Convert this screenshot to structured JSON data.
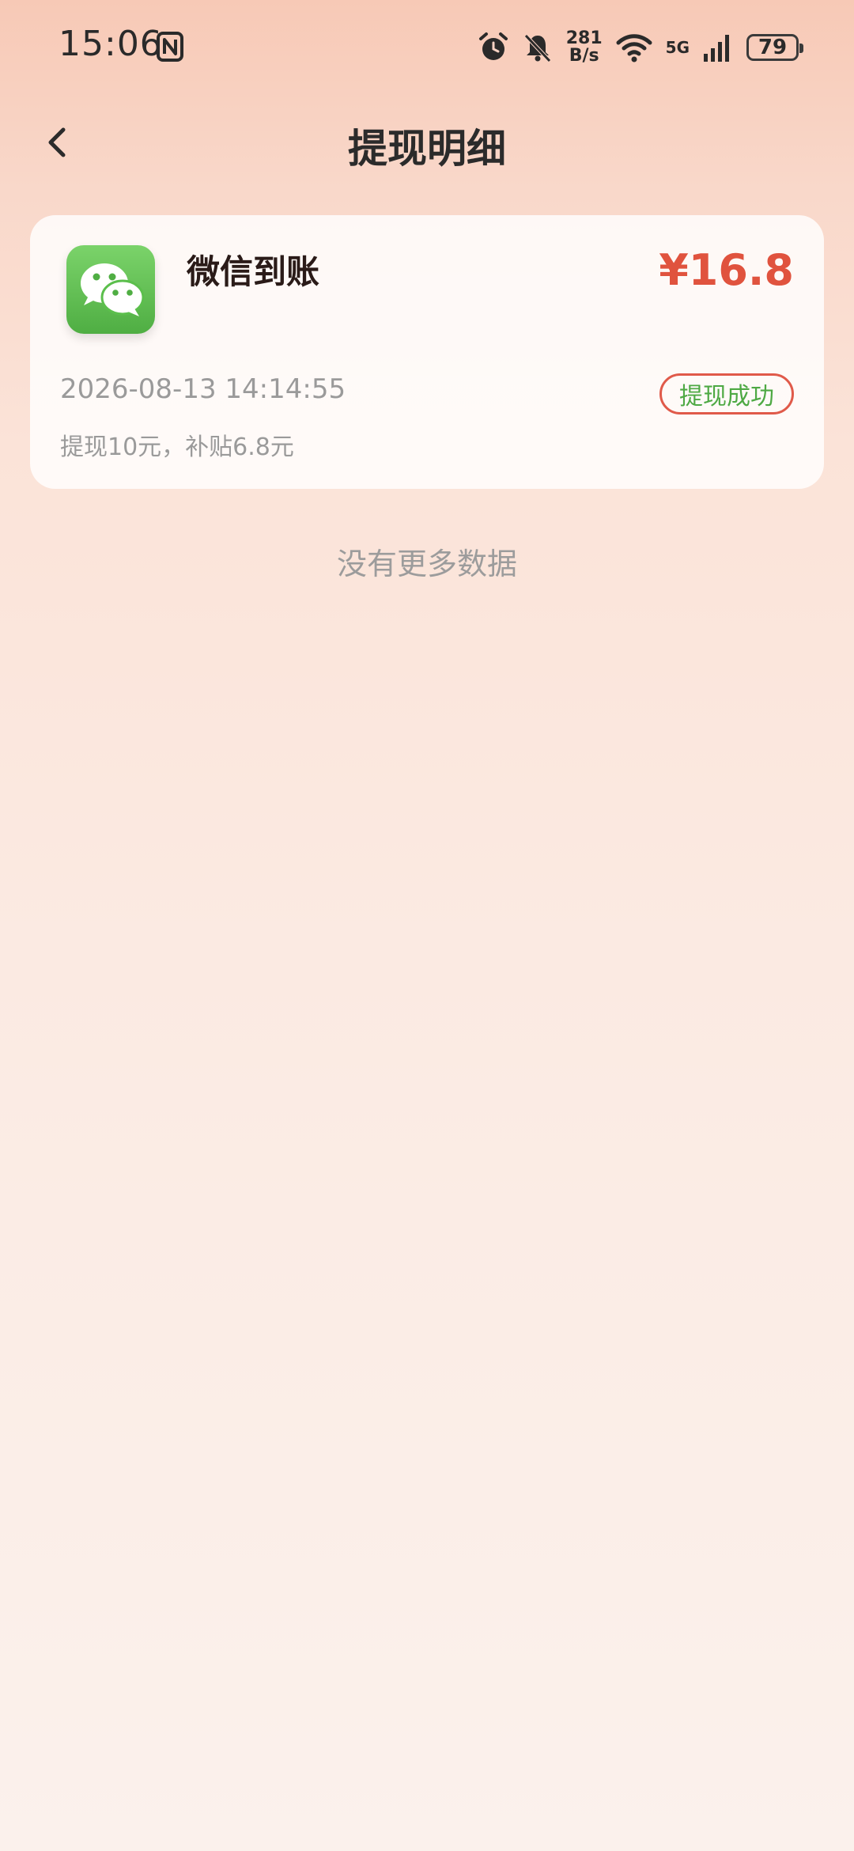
{
  "status_bar": {
    "time": "15:06",
    "speed_value": "281",
    "speed_unit": "B/s",
    "network": "5G",
    "battery": "79",
    "icons": [
      "nfc-icon",
      "alarm-icon",
      "mute-bell-icon",
      "wifi-icon",
      "signal-icon",
      "battery-icon"
    ]
  },
  "header": {
    "title": "提现明细",
    "back_icon": "chevron-left-icon"
  },
  "records": [
    {
      "icon": "wechat-icon",
      "title": "微信到账",
      "amount": "¥16.8",
      "time": "2026-08-13 14:14:55",
      "status": "提现成功",
      "desc": "提现10元，补贴6.8元"
    }
  ],
  "footer": {
    "no_more": "没有更多数据"
  },
  "colors": {
    "amount": "#e0533e",
    "status_text": "#4ea944",
    "status_border": "#e05a4a",
    "wechat_green": "#5bbf4c"
  }
}
